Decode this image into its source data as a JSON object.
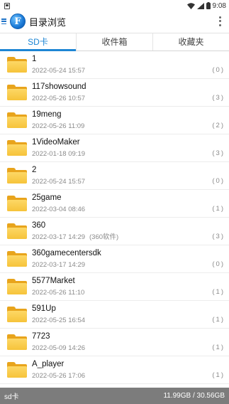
{
  "statusbar": {
    "time": "9:08"
  },
  "app": {
    "title": "目录浏览",
    "logo_letter": "F"
  },
  "tabs": [
    {
      "label": "SD卡",
      "active": true
    },
    {
      "label": "收件箱",
      "active": false
    },
    {
      "label": "收藏夹",
      "active": false
    }
  ],
  "files": [
    {
      "name": "1",
      "date": "2022-05-24 15:57",
      "note": "",
      "count": "(0)"
    },
    {
      "name": "117showsound",
      "date": "2022-05-26 10:57",
      "note": "",
      "count": "(3)"
    },
    {
      "name": "19meng",
      "date": "2022-05-26 11:09",
      "note": "",
      "count": "(2)"
    },
    {
      "name": "1VideoMaker",
      "date": "2022-01-18 09:19",
      "note": "",
      "count": "(3)"
    },
    {
      "name": "2",
      "date": "2022-05-24 15:57",
      "note": "",
      "count": "(0)"
    },
    {
      "name": "25game",
      "date": "2022-03-04 08:46",
      "note": "",
      "count": "(1)"
    },
    {
      "name": "360",
      "date": "2022-03-17 14:29",
      "note": "(360软件)",
      "count": "(3)"
    },
    {
      "name": "360gamecentersdk",
      "date": "2022-03-17 14:29",
      "note": "",
      "count": "(0)"
    },
    {
      "name": "5577Market",
      "date": "2022-05-26 11:10",
      "note": "",
      "count": "(1)"
    },
    {
      "name": "591Up",
      "date": "2022-05-25 16:54",
      "note": "",
      "count": "(1)"
    },
    {
      "name": "7723",
      "date": "2022-05-09 14:26",
      "note": "",
      "count": "(1)"
    },
    {
      "name": "A_player",
      "date": "2022-05-26 17:06",
      "note": "",
      "count": "(1)"
    }
  ],
  "footer": {
    "location": "sd卡",
    "storage": "11.99GB / 30.56GB"
  }
}
